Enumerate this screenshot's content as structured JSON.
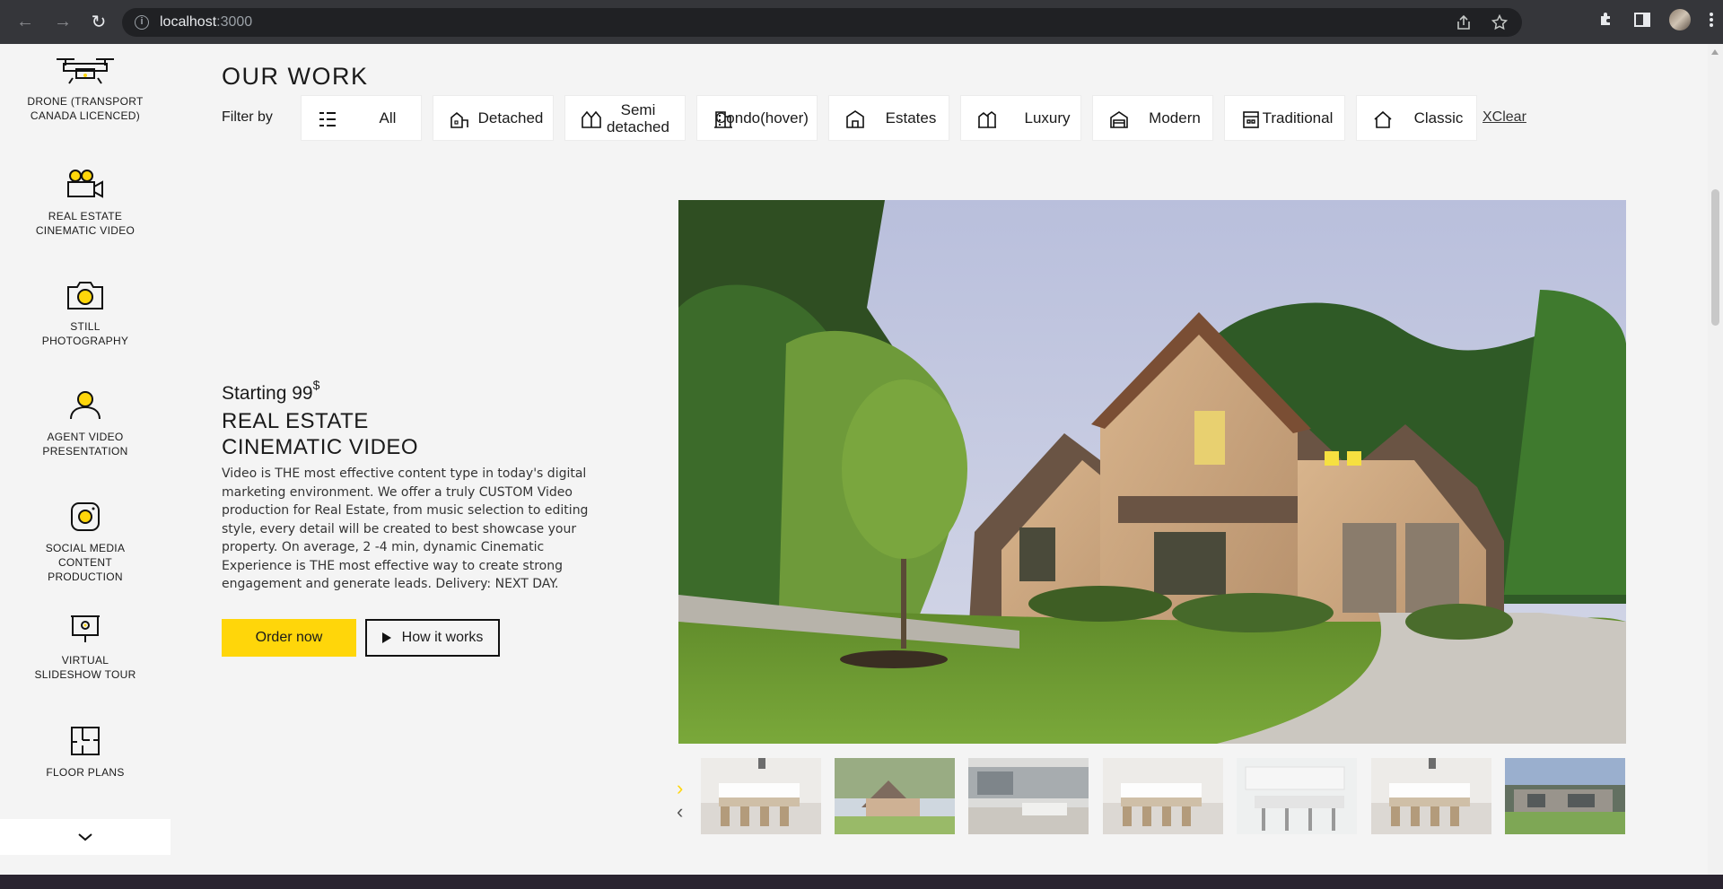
{
  "browser": {
    "url_host": "localhost",
    "url_port": ":3000"
  },
  "sidebar": {
    "items": [
      {
        "label": "DRONE (TRANSPORT CANADA LICENCED)",
        "icon": "drone-icon"
      },
      {
        "label": "REAL ESTATE CINEMATIC VIDEO",
        "icon": "video-camera-icon"
      },
      {
        "label": "STILL PHOTOGRAPHY",
        "icon": "camera-icon"
      },
      {
        "label": "AGENT VIDEO PRESENTATION",
        "icon": "person-icon"
      },
      {
        "label": "SOCIAL MEDIA CONTENT PRODUCTION",
        "icon": "instagram-icon"
      },
      {
        "label": "VIRTUAL SLIDESHOW TOUR",
        "icon": "projector-icon"
      },
      {
        "label": "FLOOR PLANS",
        "icon": "floor-plan-icon"
      }
    ]
  },
  "header": {
    "title": "OUR WORK",
    "filter_label": "Filter by",
    "clear_label": "XClear"
  },
  "filters": [
    {
      "label": "All",
      "icon": "grid-list-icon"
    },
    {
      "label": "Detached",
      "icon": "detached-house-icon"
    },
    {
      "label": "Semi detached",
      "icon": "semi-detached-icon"
    },
    {
      "label": "Condo(hover)",
      "icon": "condo-icon"
    },
    {
      "label": "Estates",
      "icon": "estate-icon"
    },
    {
      "label": "Luxury",
      "icon": "luxury-icon"
    },
    {
      "label": "Modern",
      "icon": "modern-house-icon"
    },
    {
      "label": "Traditional",
      "icon": "traditional-icon"
    },
    {
      "label": "Classic",
      "icon": "classic-house-icon"
    }
  ],
  "feature": {
    "starting": "Starting 99",
    "currency": "$",
    "title_line1": "REAL ESTATE",
    "title_line2": "CINEMATIC VIDEO",
    "description": "Video is THE most effective content type in today's digital marketing environment. We offer a truly CUSTOM Video production for Real Estate, from music selection to editing style, every detail will be created to best showcase your property. On average, 2 -4 min, dynamic Cinematic Experience is THE most effective way to create strong engagement and generate leads. Delivery: NEXT DAY.",
    "order_label": "Order now",
    "how_label": "How it works"
  },
  "colors": {
    "accent": "#ffd60a",
    "page_bg": "#f4f4f4",
    "chrome_bg": "#35363a"
  }
}
